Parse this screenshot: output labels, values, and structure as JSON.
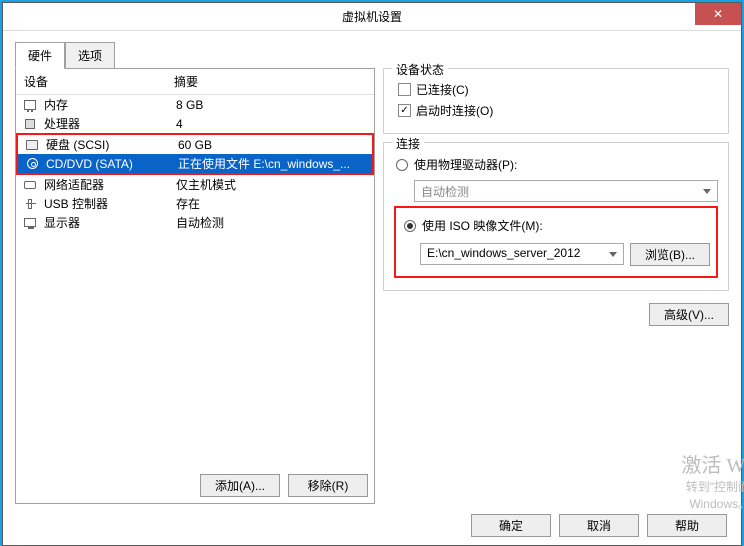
{
  "title": "虚拟机设置",
  "tabs": {
    "hardware": "硬件",
    "options": "选项"
  },
  "columns": {
    "device": "设备",
    "summary": "摘要"
  },
  "devices": [
    {
      "name": "内存",
      "summary": "8 GB",
      "icon": "memory-icon"
    },
    {
      "name": "处理器",
      "summary": "4",
      "icon": "cpu-icon"
    },
    {
      "name": "硬盘 (SCSI)",
      "summary": "60 GB",
      "icon": "disk-icon"
    },
    {
      "name": "CD/DVD (SATA)",
      "summary": "正在使用文件 E:\\cn_windows_...",
      "icon": "cd-icon"
    },
    {
      "name": "网络适配器",
      "summary": "仅主机模式",
      "icon": "network-icon"
    },
    {
      "name": "USB 控制器",
      "summary": "存在",
      "icon": "usb-icon"
    },
    {
      "name": "显示器",
      "summary": "自动检测",
      "icon": "display-icon"
    }
  ],
  "left_buttons": {
    "add": "添加(A)...",
    "remove": "移除(R)"
  },
  "status": {
    "group": "设备状态",
    "connected": "已连接(C)",
    "connect_poweron": "启动时连接(O)"
  },
  "connection": {
    "group": "连接",
    "physical": "使用物理驱动器(P):",
    "physical_combo": "自动检测",
    "iso": "使用 ISO 映像文件(M):",
    "iso_path": "E:\\cn_windows_server_2012",
    "browse": "浏览(B)..."
  },
  "advanced": "高级(V)...",
  "footer": {
    "ok": "确定",
    "cancel": "取消",
    "help": "帮助"
  },
  "watermark": {
    "big": "激活 Wi",
    "small": "转到\"控制面",
    "small2": "Windows。"
  }
}
